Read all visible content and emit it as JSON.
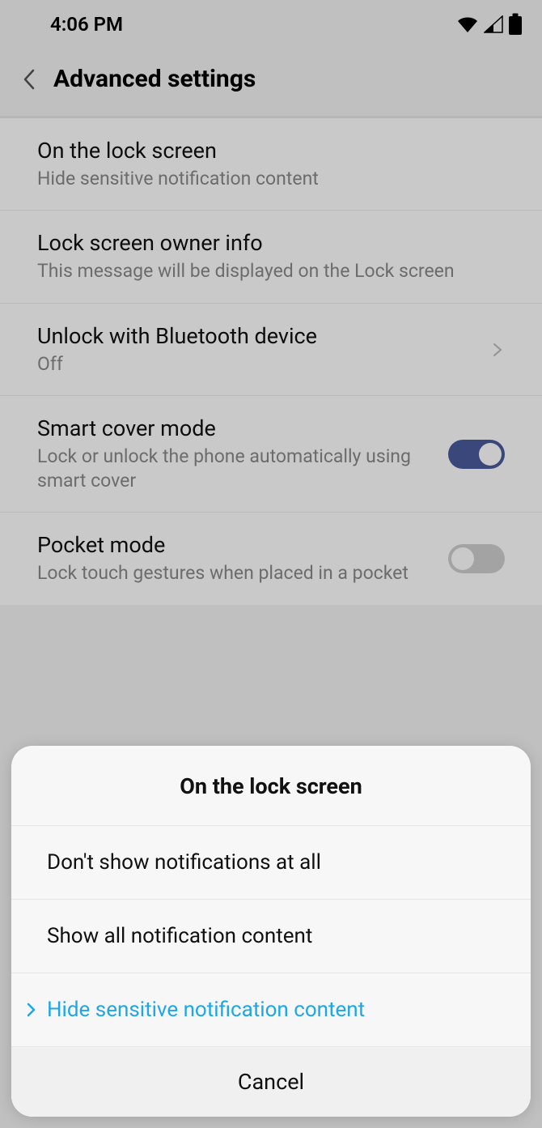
{
  "status": {
    "time": "4:06 PM"
  },
  "appbar": {
    "title": "Advanced settings"
  },
  "settings": {
    "item0": {
      "title": "On the lock screen",
      "sub": "Hide sensitive notification content"
    },
    "item1": {
      "title": "Lock screen owner info",
      "sub": "This message will be displayed on the Lock screen"
    },
    "item2": {
      "title": "Unlock with Bluetooth device",
      "sub": "Off"
    },
    "item3": {
      "title": "Smart cover mode",
      "sub": "Lock or unlock the phone automatically using smart cover",
      "switch": "on"
    },
    "item4": {
      "title": "Pocket mode",
      "sub": "Lock touch gestures when placed in a pocket",
      "switch": "off"
    }
  },
  "sheet": {
    "title": "On the lock screen",
    "opt0": "Don't show notifications at all",
    "opt1": "Show all notification content",
    "opt2": "Hide sensitive notification content",
    "cancel": "Cancel"
  }
}
